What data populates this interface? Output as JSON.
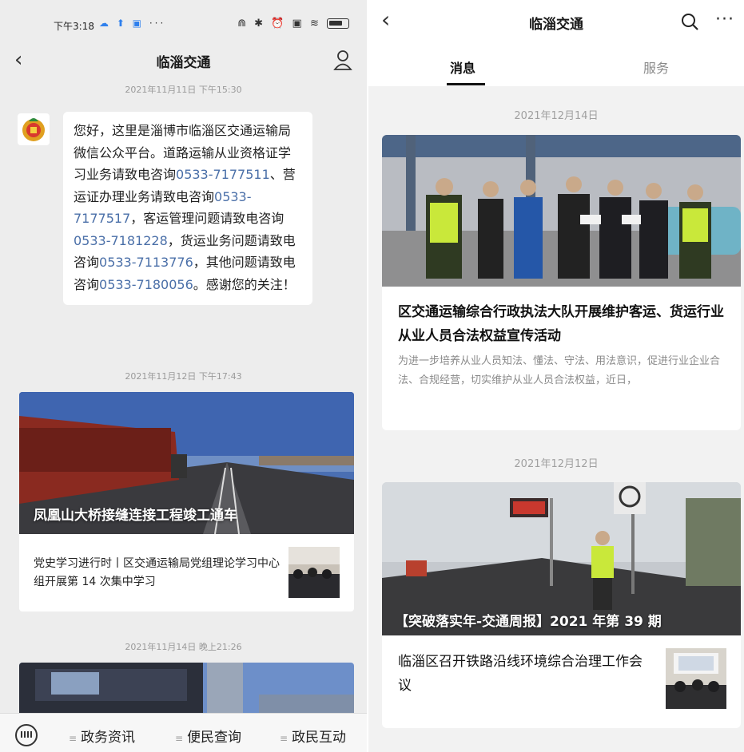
{
  "left_screen": {
    "status_bar": {
      "time": "下午3:18",
      "dots": "···"
    },
    "nav": {
      "title": "临淄交通"
    },
    "messages": [
      {
        "timestamp": "2021年11月11日 下午15:30",
        "bubble_parts": [
          {
            "text": "您好，这里是淄博市临淄区交通运输局微信公众平台。道路运输从业资格证学习业务请致电咨询",
            "phone": false
          },
          {
            "text": "0533-7177511",
            "phone": true
          },
          {
            "text": "、营运证办理业务请致电咨询",
            "phone": false
          },
          {
            "text": "0533-7177517",
            "phone": true
          },
          {
            "text": "，客运管理问题请致电咨询",
            "phone": false
          },
          {
            "text": "0533-7181228",
            "phone": true
          },
          {
            "text": "，货运业务问题请致电咨询",
            "phone": false
          },
          {
            "text": "0533-7113776",
            "phone": true
          },
          {
            "text": "，其他问题请致电咨询",
            "phone": false
          },
          {
            "text": "0533-7180056",
            "phone": true
          },
          {
            "text": "。感谢您的关注！",
            "phone": false
          }
        ]
      }
    ],
    "article_group_1": {
      "timestamp": "2021年11月12日 下午17:43",
      "hero_title": "凤凰山大桥接缝连接工程竣工通车",
      "sub_title": "党史学习进行时丨区交通运输局党组理论学习中心组开展第 14 次集中学习"
    },
    "article_group_2": {
      "timestamp": "2021年11月14日 晚上21:26"
    },
    "bottom_menu": [
      "政务资讯",
      "便民查询",
      "政民互动"
    ]
  },
  "right_screen": {
    "nav": {
      "title": "临淄交通"
    },
    "tabs": {
      "active": "消息",
      "inactive": "服务"
    },
    "posts": [
      {
        "date": "2021年12月14日",
        "title": "区交通运输综合行政执法大队开展维护客运、货运行业从业人员合法权益宣传活动",
        "description": "为进一步培养从业人员知法、懂法、守法、用法意识，促进行业企业合法、合规经营，切实维护从业人员合法权益，近日，"
      },
      {
        "date": "2021年12月12日",
        "hero_title": "【突破落实年-交通周报】2021 年第 39 期",
        "sub_title": "临淄区召开铁路沿线环境综合治理工作会议"
      }
    ]
  },
  "colors": {
    "link_blue": "#4a6fa8",
    "chat_bg": "#ededed",
    "feed_bg": "#f2f2f2"
  }
}
